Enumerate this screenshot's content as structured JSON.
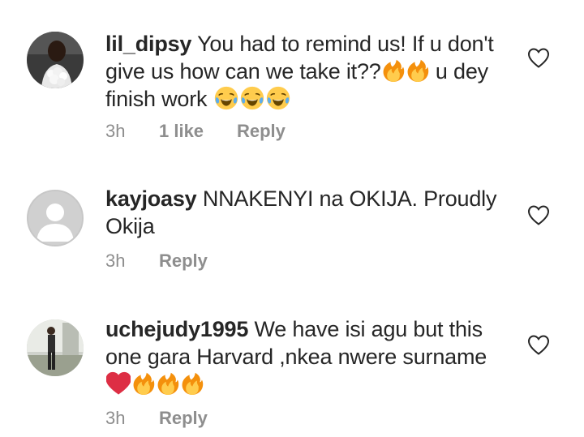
{
  "comments": [
    {
      "username": "lil_dipsy",
      "text_line1": "You had to remind us! If u don't",
      "text_line2": "give us how can we take it??",
      "text_line2_tail": "u dey",
      "text_line3": "finish work",
      "time": "3h",
      "likes": "1 like",
      "reply": "Reply"
    },
    {
      "username": "kayjoasy",
      "text_line1": "NNAKENYI na OKIJA. Proudly",
      "text_line2": "Okija",
      "time": "3h",
      "reply": "Reply"
    },
    {
      "username": "uchejudy1995",
      "text_line1": "We have isi agu but this",
      "text_line2": "one gara Harvard ,nkea nwere surname",
      "time": "3h",
      "reply": "Reply"
    }
  ],
  "icons": {
    "like": "heart-outline-icon",
    "fire": "fire-emoji",
    "laugh": "tears-of-joy-emoji",
    "red_heart": "red-heart-emoji"
  },
  "colors": {
    "text": "#262626",
    "meta": "#8e8e8e",
    "fire_outer": "#f4900c",
    "fire_inner": "#ffcc4d",
    "heart": "#dd2e44"
  }
}
